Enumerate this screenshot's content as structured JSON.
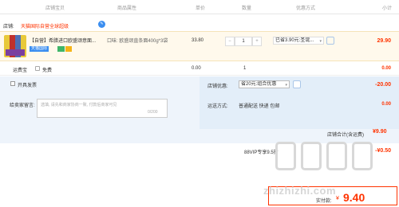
{
  "table_header": {
    "col_shop": "店铺宝贝",
    "col_attr": "商品属性",
    "col_price": "单价",
    "col_qty": "数量",
    "col_discount": "优惠方式",
    "col_subtotal": "小计"
  },
  "shop": {
    "label": "店铺:",
    "name": "天猫国际自营全球超级"
  },
  "item": {
    "title": "【自营】希腊进口欧盛颂意面...",
    "tag": "天猫国际",
    "attr": "口味: 欧盛颂直条面400g*3袋",
    "price": "33.80",
    "quantity": "1",
    "discount": "已省3.90元:圣诞...",
    "subtotal": "29.90"
  },
  "service": {
    "label": "运费宝",
    "option": "免费",
    "price": "0.00",
    "quantity": "1",
    "subtotal": "0.00"
  },
  "invoice": {
    "label": "开具发票"
  },
  "message": {
    "label": "给卖家留言:",
    "placeholder": "选填, 请先和商家协商一致, 付款后商家可见",
    "count": "0/200"
  },
  "shop_discount": {
    "label": "店铺优惠:",
    "value": "省20元:组合优惠",
    "amount": "-20.00"
  },
  "shipping": {
    "label": "运送方式:",
    "value": "普通配送 快递 包邮",
    "amount": "0.00"
  },
  "shop_total": {
    "label": "店铺合计(含运费)",
    "value": "¥9.90"
  },
  "vip": {
    "label": "88VIP专享9.5折",
    "value": "",
    "amount": "-¥0.50"
  },
  "payment": {
    "label": "实付款:",
    "currency": "¥",
    "value": "9.40"
  },
  "watermark": {
    "text": "zhizhizhi.com"
  }
}
